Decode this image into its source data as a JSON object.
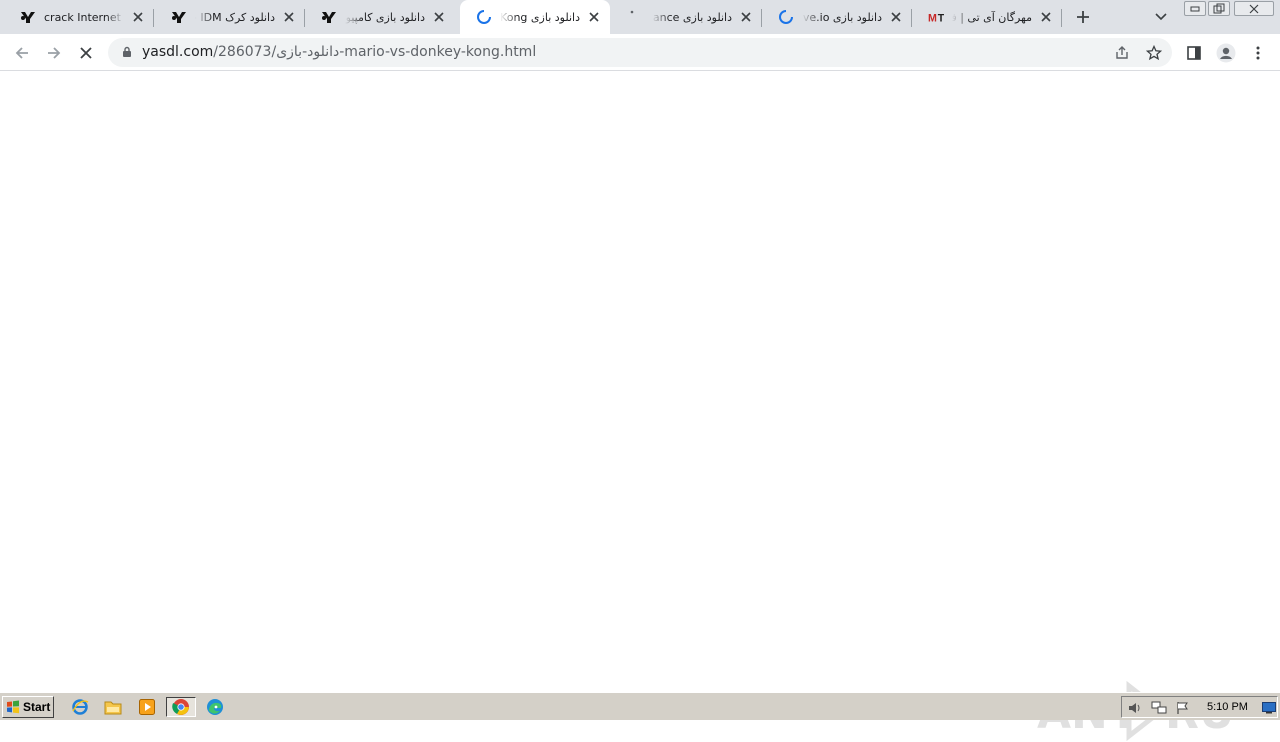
{
  "browser": {
    "tabs": [
      {
        "title": "crack Internet Dow",
        "favicon": "yasdl-logo-icon",
        "active": false,
        "dir": "ltr"
      },
      {
        "title": "دانلود کرک IDM جد",
        "favicon": "yasdl-logo-icon",
        "active": false,
        "dir": "rtl"
      },
      {
        "title": "دانلود بازی کامپیوتر",
        "favicon": "yasdl-logo-icon",
        "active": false,
        "dir": "rtl"
      },
      {
        "title": "دانلود بازی Mario vs Donkey Kong",
        "favicon": "loading-spinner-icon",
        "active": true,
        "dir": "rtl"
      },
      {
        "title": "دانلود بازی Defiance",
        "favicon": "loading-dot-icon",
        "active": false,
        "dir": "rtl"
      },
      {
        "title": "دانلود بازی Drive.io",
        "favicon": "loading-spinner-icon",
        "active": false,
        "dir": "rtl"
      },
      {
        "title": "مهرگان آی تی | فروشگاه",
        "favicon": "mit-logo-icon",
        "active": false,
        "dir": "rtl"
      }
    ],
    "url_host": "yasdl.com",
    "url_path": "/286073/دانلود-بازی-mario-vs-donkey-kong.html"
  },
  "watermark": {
    "text": "ANY RUN"
  },
  "taskbar": {
    "start_label": "Start",
    "clock": "5:10 PM"
  },
  "colors": {
    "tabstrip": "#dee1e6",
    "accent_blue": "#1a73e8",
    "taskbar": "#d4d0c8"
  }
}
